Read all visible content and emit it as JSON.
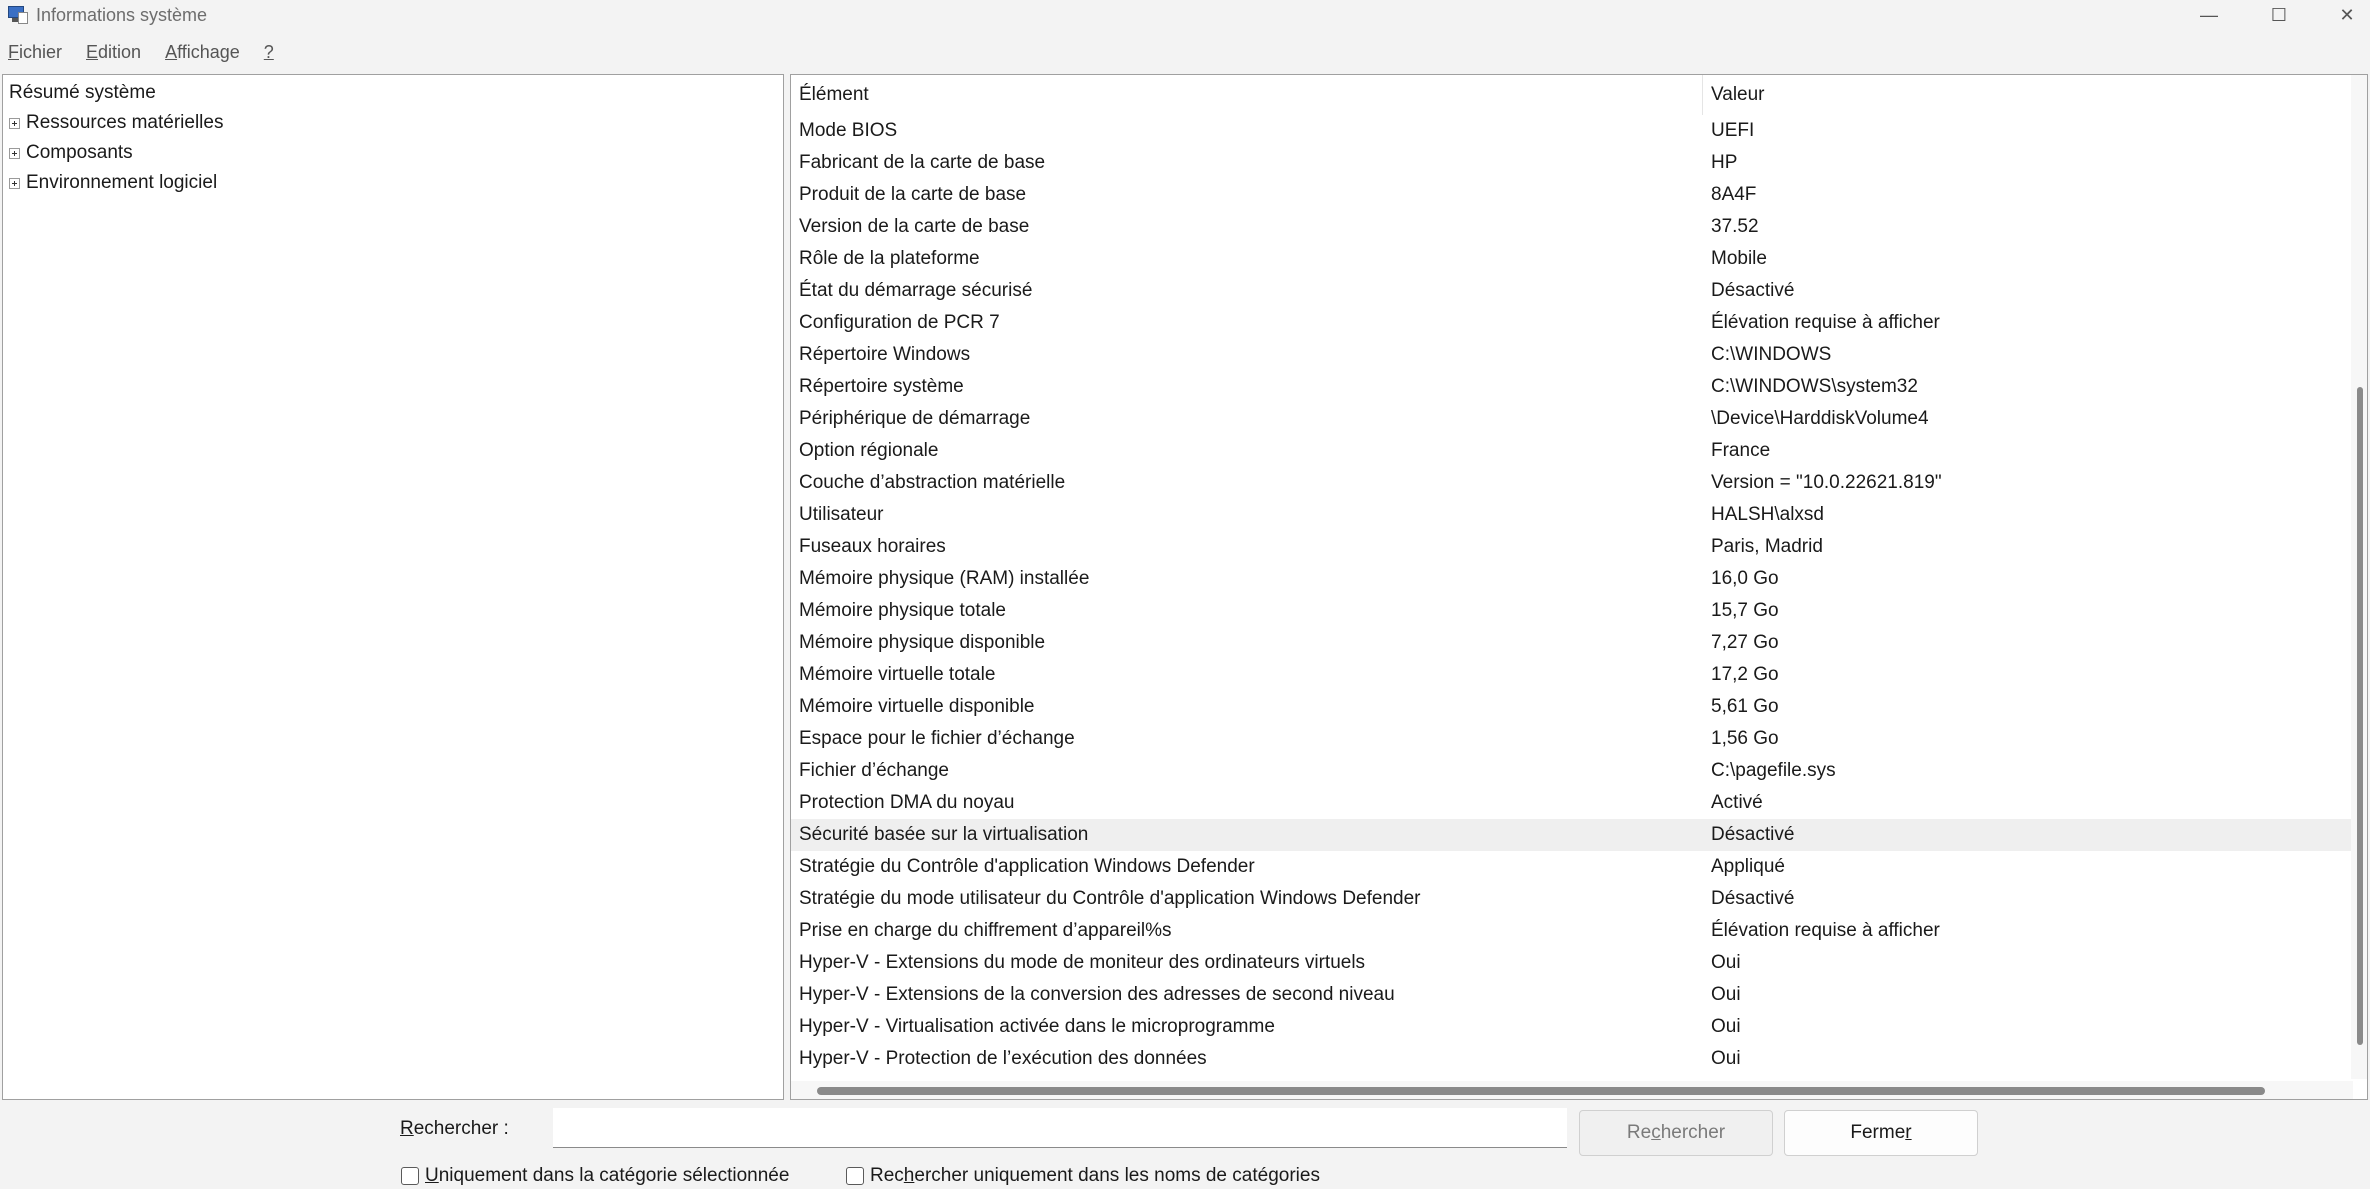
{
  "window": {
    "title": "Informations système",
    "controls": {
      "minimize": "—",
      "maximize": "☐",
      "close": "✕"
    }
  },
  "menu": {
    "fichier": {
      "u": "F",
      "rest": "ichier"
    },
    "edition": {
      "u": "E",
      "rest": "dition"
    },
    "affichage": {
      "u": "A",
      "rest": "ffichage"
    },
    "help": {
      "u": "?",
      "rest": ""
    }
  },
  "tree": {
    "root": "Résumé système",
    "items": [
      {
        "label": "Ressources matérielles"
      },
      {
        "label": "Composants"
      },
      {
        "label": "Environnement logiciel"
      }
    ]
  },
  "table": {
    "headers": {
      "element": "Élément",
      "valeur": "Valeur"
    },
    "rows": [
      {
        "element": "Mode BIOS",
        "valeur": "UEFI"
      },
      {
        "element": "Fabricant de la carte de base",
        "valeur": "HP"
      },
      {
        "element": "Produit de la carte de base",
        "valeur": "8A4F"
      },
      {
        "element": "Version de la carte de base",
        "valeur": "37.52"
      },
      {
        "element": "Rôle de la plateforme",
        "valeur": "Mobile"
      },
      {
        "element": "État du démarrage sécurisé",
        "valeur": "Désactivé"
      },
      {
        "element": "Configuration de PCR 7",
        "valeur": "Élévation requise à afficher"
      },
      {
        "element": "Répertoire Windows",
        "valeur": "C:\\WINDOWS"
      },
      {
        "element": "Répertoire système",
        "valeur": "C:\\WINDOWS\\system32"
      },
      {
        "element": "Périphérique de démarrage",
        "valeur": "\\Device\\HarddiskVolume4"
      },
      {
        "element": "Option régionale",
        "valeur": "France"
      },
      {
        "element": "Couche d’abstraction matérielle",
        "valeur": "Version = \"10.0.22621.819\""
      },
      {
        "element": "Utilisateur",
        "valeur": "HALSH\\alxsd"
      },
      {
        "element": "Fuseaux horaires",
        "valeur": "Paris, Madrid"
      },
      {
        "element": "Mémoire physique (RAM) installée",
        "valeur": "16,0 Go"
      },
      {
        "element": "Mémoire physique totale",
        "valeur": "15,7 Go"
      },
      {
        "element": "Mémoire physique disponible",
        "valeur": "7,27 Go"
      },
      {
        "element": "Mémoire virtuelle totale",
        "valeur": "17,2 Go"
      },
      {
        "element": "Mémoire virtuelle disponible",
        "valeur": "5,61 Go"
      },
      {
        "element": "Espace pour le fichier d’échange",
        "valeur": "1,56 Go"
      },
      {
        "element": "Fichier d’échange",
        "valeur": "C:\\pagefile.sys"
      },
      {
        "element": "Protection DMA du noyau",
        "valeur": "Activé"
      },
      {
        "element": "Sécurité basée sur la virtualisation",
        "valeur": "Désactivé",
        "selected": true
      },
      {
        "element": "Stratégie du Contrôle d'application Windows Defender",
        "valeur": "Appliqué"
      },
      {
        "element": "Stratégie du mode utilisateur du Contrôle d'application Windows Defender",
        "valeur": "Désactivé"
      },
      {
        "element": "Prise en charge du chiffrement d’appareil%s",
        "valeur": "Élévation requise à afficher"
      },
      {
        "element": "Hyper-V - Extensions du mode de moniteur des ordinateurs virtuels",
        "valeur": "Oui"
      },
      {
        "element": "Hyper-V - Extensions de la conversion des adresses de second niveau",
        "valeur": "Oui"
      },
      {
        "element": "Hyper-V - Virtualisation activée dans le microprogramme",
        "valeur": "Oui"
      },
      {
        "element": "Hyper-V - Protection de l’exécution des données",
        "valeur": "Oui"
      }
    ]
  },
  "search": {
    "label_u": "R",
    "label_rest": "echercher :",
    "value": "",
    "search_button": {
      "pre": "Re",
      "u": "c",
      "post": "hercher"
    },
    "close_button": {
      "pre": "Ferme",
      "u": "r",
      "post": ""
    },
    "check_selected_category": {
      "pre": "",
      "u": "U",
      "post": "niquement dans la catégorie sélectionnée"
    },
    "check_category_names": {
      "pre": "Rec",
      "u": "h",
      "post": "ercher uniquement dans les noms de catégories"
    }
  }
}
